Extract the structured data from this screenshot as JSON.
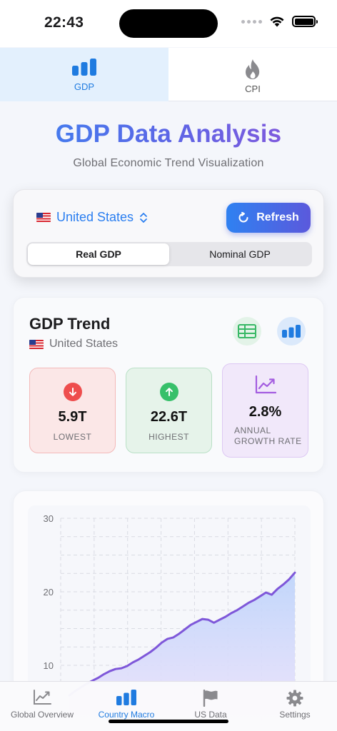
{
  "status_bar": {
    "time": "22:43"
  },
  "top_tabs": [
    {
      "label": "GDP",
      "icon": "bar-chart-icon",
      "active": true
    },
    {
      "label": "CPI",
      "icon": "flame-icon",
      "active": false
    }
  ],
  "header": {
    "title": "GDP Data Analysis",
    "subtitle": "Global Economic Trend Visualization"
  },
  "controls": {
    "country": "United States",
    "refresh_label": "Refresh",
    "segments": [
      "Real GDP",
      "Nominal GDP"
    ],
    "selected_segment": "Real GDP"
  },
  "trend": {
    "title": "GDP Trend",
    "country": "United States",
    "stats": {
      "lowest": {
        "value": "5.9T",
        "label": "LOWEST"
      },
      "highest": {
        "value": "22.6T",
        "label": "HIGHEST"
      },
      "growth": {
        "value": "2.8%",
        "label": "ANNUAL GROWTH RATE"
      }
    }
  },
  "chart_data": {
    "type": "area",
    "title": "",
    "xlabel": "",
    "ylabel": "",
    "ylim": [
      0,
      30
    ],
    "yticks": [
      10,
      20,
      30
    ],
    "grid": true,
    "y": [
      5.9,
      6.5,
      7.0,
      7.5,
      7.9,
      8.3,
      8.8,
      9.2,
      9.5,
      9.6,
      9.9,
      10.4,
      10.8,
      11.3,
      11.8,
      12.4,
      13.1,
      13.6,
      13.8,
      14.3,
      14.9,
      15.5,
      15.9,
      16.3,
      16.2,
      15.8,
      16.2,
      16.6,
      17.1,
      17.5,
      18.0,
      18.5,
      18.9,
      19.4,
      19.9,
      19.6,
      20.4,
      21.0,
      21.7,
      22.6
    ],
    "colors": {
      "line": "#7e57d9",
      "fill_top": "#bcd3fb",
      "fill_bottom": "#f1e3fb"
    }
  },
  "bottom_tabs": [
    {
      "label": "Global Overview",
      "icon": "line-chart-icon",
      "active": false
    },
    {
      "label": "Country Macro",
      "icon": "bar-chart-icon",
      "active": true
    },
    {
      "label": "US Data",
      "icon": "flag-icon",
      "active": false
    },
    {
      "label": "Settings",
      "icon": "gear-icon",
      "active": false
    }
  ],
  "colors": {
    "accent": "#1f7be0",
    "lowest": "#ee4e4e",
    "highest": "#37c06a",
    "growth": "#a45de0"
  }
}
